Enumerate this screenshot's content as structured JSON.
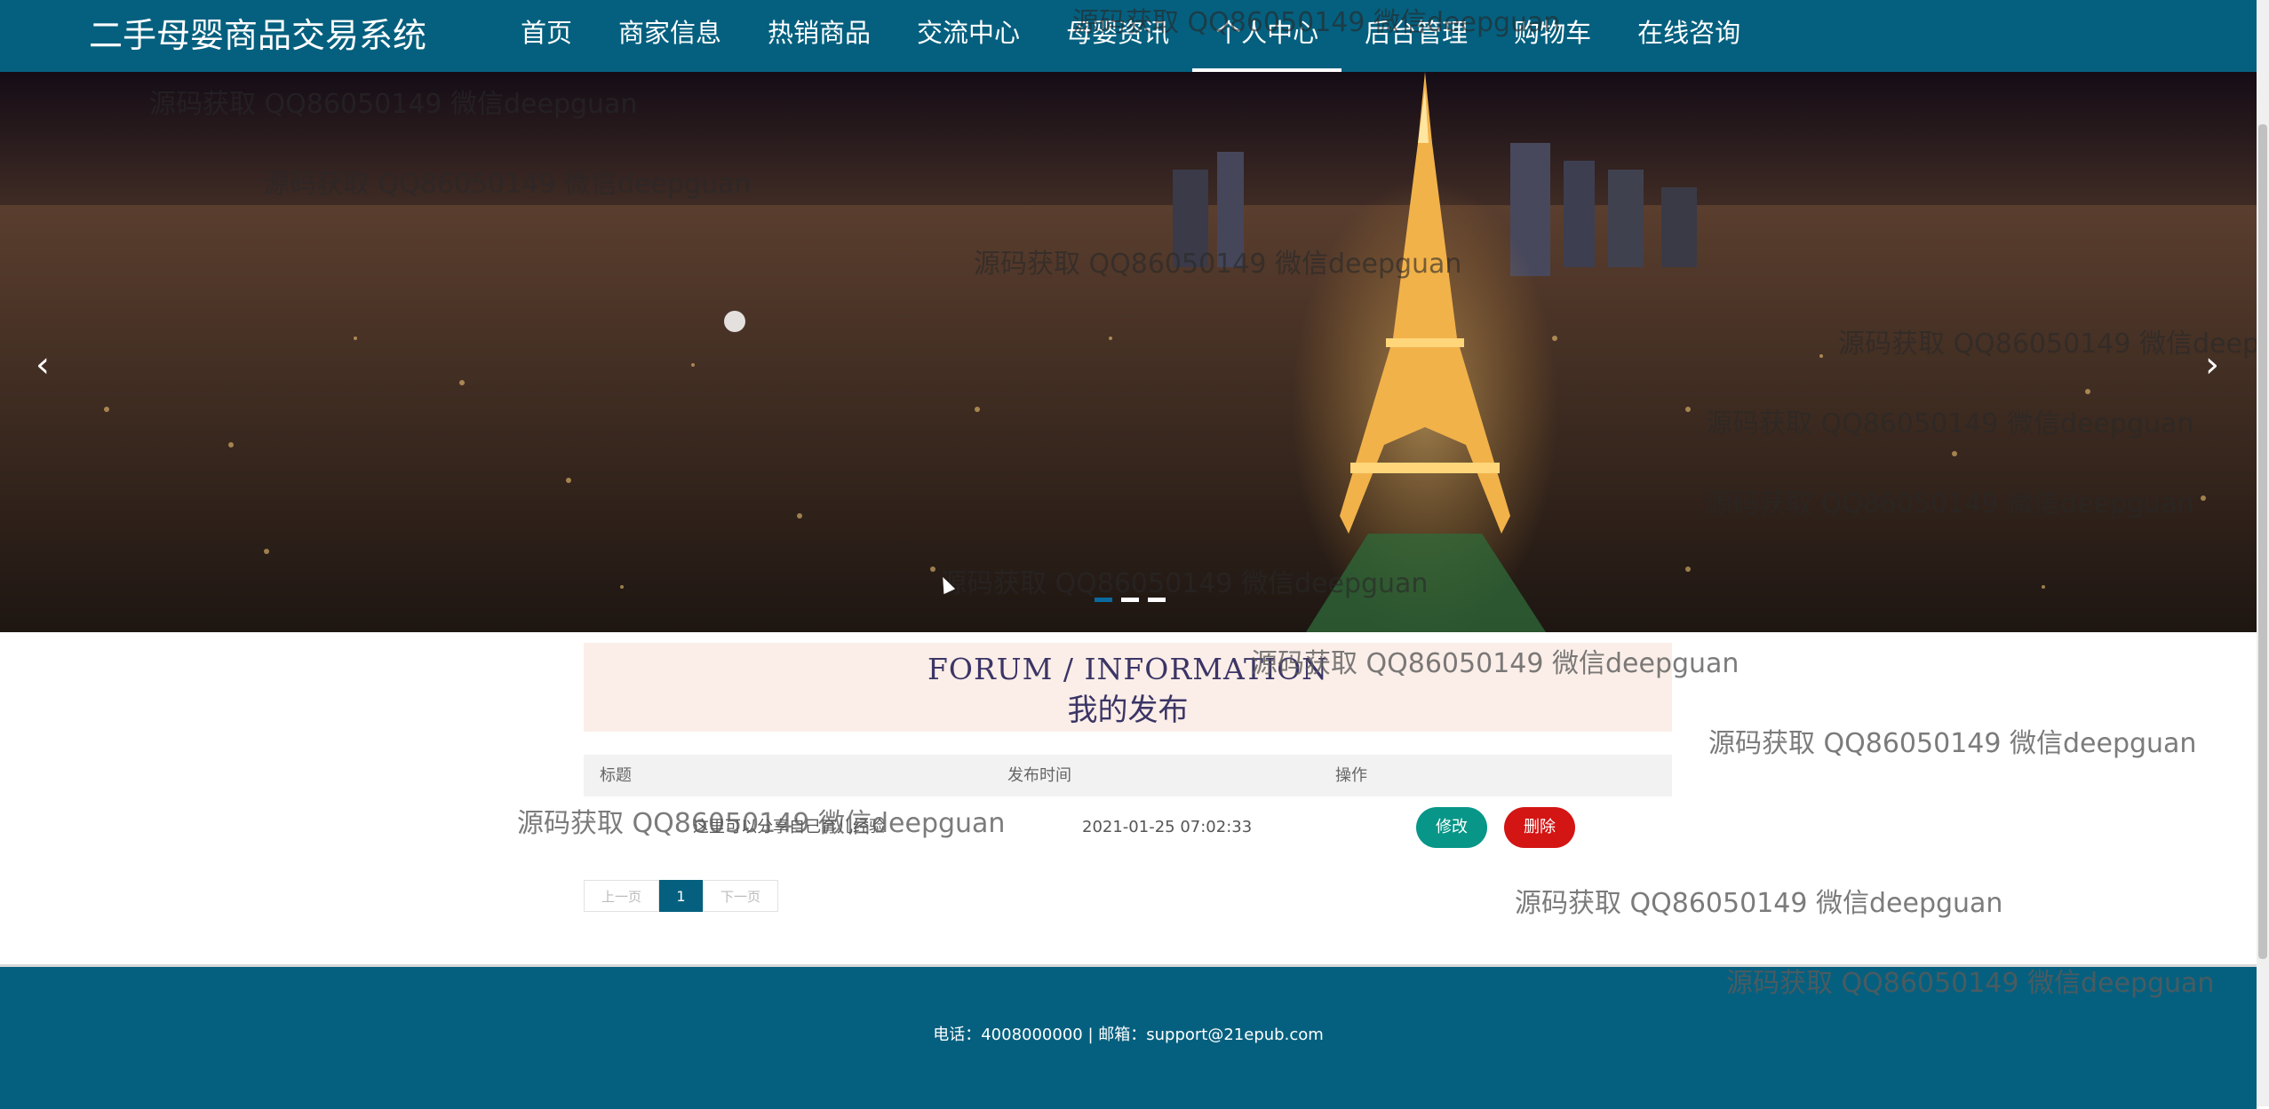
{
  "app": {
    "title": "二手母婴商品交易系统"
  },
  "nav": {
    "items": [
      {
        "label": "首页"
      },
      {
        "label": "商家信息"
      },
      {
        "label": "热销商品"
      },
      {
        "label": "交流中心"
      },
      {
        "label": "母婴资讯"
      },
      {
        "label": "个人中心",
        "active": true
      },
      {
        "label": "后台管理"
      },
      {
        "label": "购物车"
      },
      {
        "label": "在线咨询"
      }
    ]
  },
  "banner": {
    "prev_arrow": "‹",
    "next_arrow": "›",
    "slide_count": 3,
    "active_slide": 1
  },
  "section": {
    "title_en": "FORUM / INFORMATION",
    "title_cn": "我的发布"
  },
  "table": {
    "headers": [
      "标题",
      "发布时间",
      "操作"
    ],
    "rows": [
      {
        "title": "这里可以分享自己育儿经验",
        "time": "2021-01-25 07:02:33",
        "edit_label": "修改",
        "delete_label": "删除"
      }
    ]
  },
  "pagination": {
    "prev": "上一页",
    "current": "1",
    "next": "下一页"
  },
  "footer": {
    "contact": "电话：4008000000 | 邮箱：support@21epub.com"
  },
  "watermark": {
    "text": "源码获取 QQ86050149 微信deepguan"
  },
  "colors": {
    "primary": "#05607f",
    "edit_button": "#079688",
    "delete_button": "#d31514",
    "section_bg": "#fbeee8"
  }
}
